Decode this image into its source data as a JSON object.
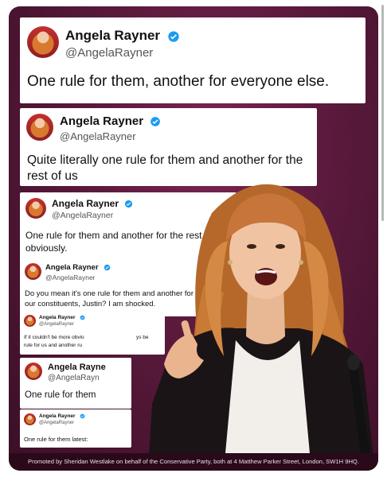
{
  "tweets": [
    {
      "name": "Angela Rayner",
      "handle": "@AngelaRayner",
      "text": "One rule for them, another for everyone else."
    },
    {
      "name": "Angela Rayner",
      "handle": "@AngelaRayner",
      "text": "Quite literally one rule for them and another for the rest of us"
    },
    {
      "name": "Angela Rayner",
      "handle": "@AngelaRayner",
      "text": "One rule for them and another for the rest of us, obviously."
    },
    {
      "name": "Angela Rayner",
      "handle": "@AngelaRayner",
      "text": "Do you mean it's one rule for them and another for our constituents, Justin? I am shocked."
    },
    {
      "name": "Angela Rayner",
      "handle": "@AngelaRayner",
      "text": "If it couldn't be more obvio",
      "text_line2": "rule for us and another ru",
      "text_tail": "ys be"
    },
    {
      "name": "Angela Rayne",
      "handle": "@AngelaRayn",
      "text": "One rule for them"
    },
    {
      "name": "Angela Rayner",
      "handle": "@AngelaRayner",
      "text": "One rule for them latest:"
    }
  ],
  "footer": "Promoted by Sheridan Westlake on behalf of the Conservative Party, both at 4 Matthew Parker Street, London, SW1H 9HQ.",
  "colors": {
    "verified": "#1d9bf0",
    "background": "#5c1a3d"
  },
  "icons": {
    "verified": "verified-badge-icon"
  }
}
